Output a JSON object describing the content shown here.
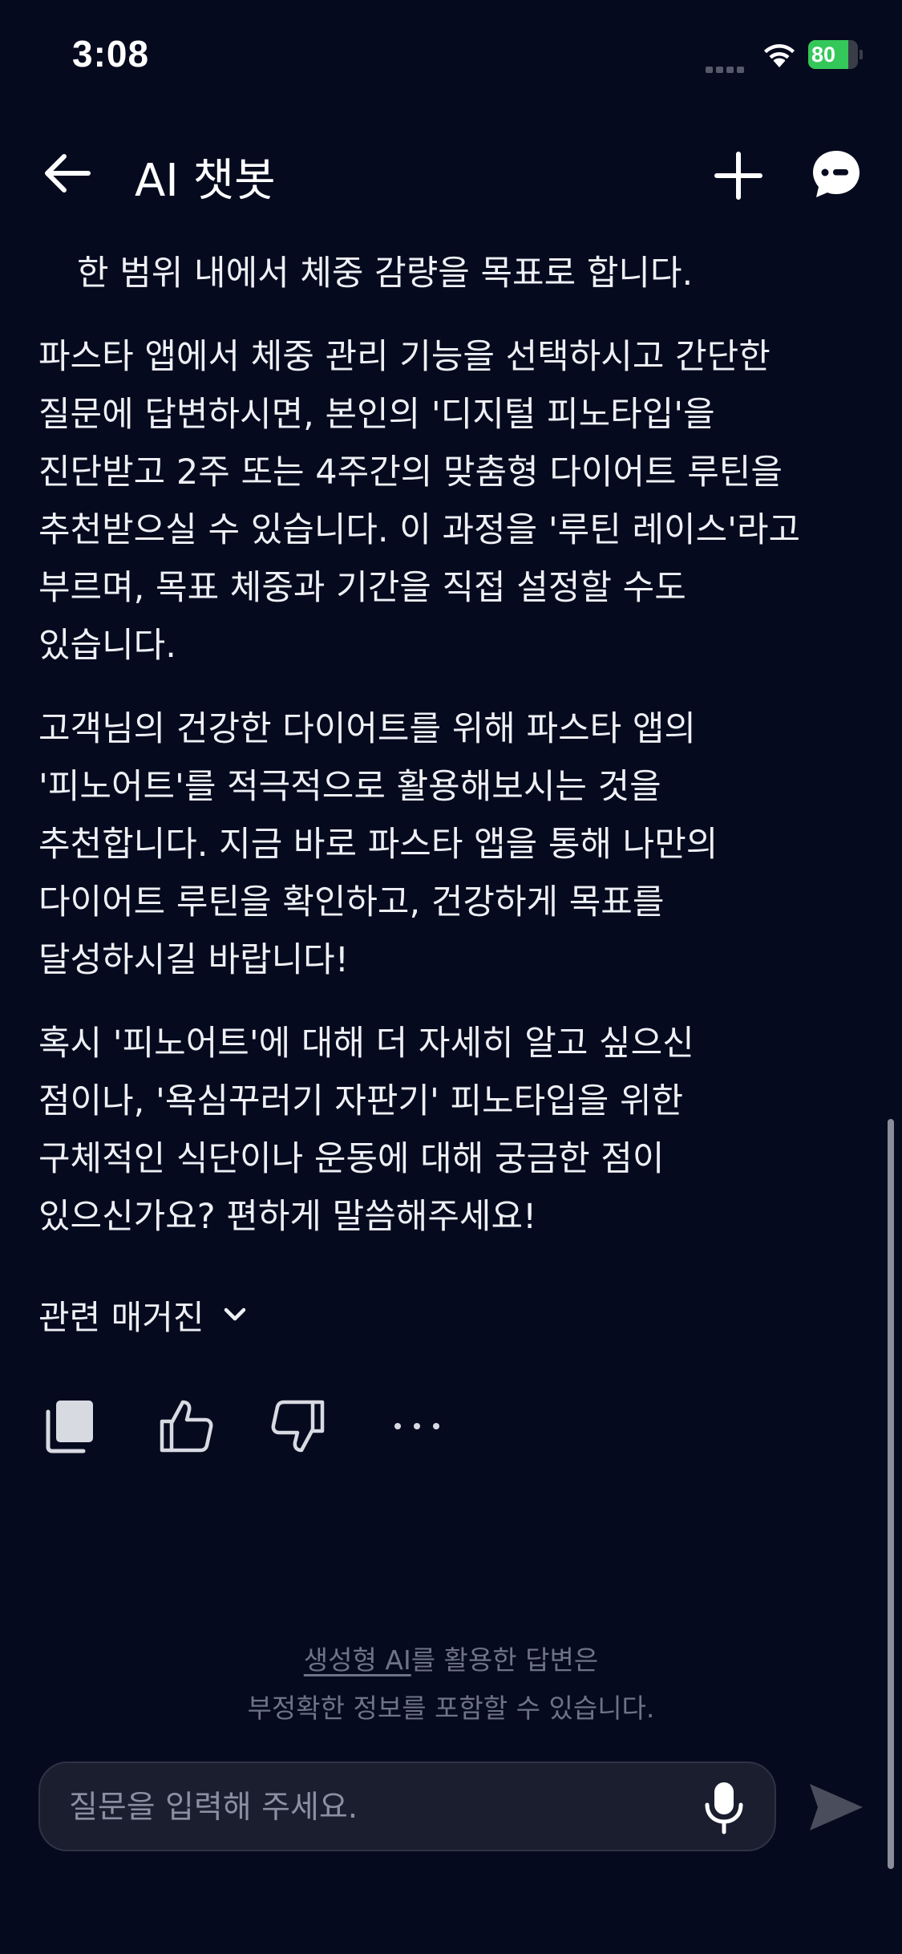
{
  "status_bar": {
    "time": "3:08",
    "battery_level": "80",
    "battery_fraction": 0.8,
    "signal_icon": "signal-dots-icon",
    "wifi_icon": "wifi-icon",
    "battery_icon": "battery-charging-icon"
  },
  "header": {
    "title": "AI 챗봇",
    "back_icon": "arrow-left-icon",
    "new_chat_icon": "plus-icon",
    "history_icon": "chat-bubble-icon"
  },
  "message": {
    "paragraphs": [
      "한 범위 내에서 체중 감량을 목표로 합니다.",
      "파스타 앱에서 체중 관리 기능을 선택하시고 간단한 질문에 답변하시면, 본인의 '디지털 피노타입'을 진단받고 2주 또는 4주간의 맞춤형 다이어트 루틴을 추천받으실 수 있습니다. 이 과정을 '루틴 레이스'라고 부르며, 목표 체중과 기간을 직접 설정할 수도 있습니다.",
      "고객님의 건강한 다이어트를 위해 파스타 앱의 '피노어트'를 적극적으로 활용해보시는 것을 추천합니다. 지금 바로 파스타 앱을 통해 나만의 다이어트 루틴을 확인하고, 건강하게 목표를 달성하시길 바랍니다!",
      "혹시 '피노어트'에 대해 더 자세히 알고 싶으신 점이나, '욕심꾸러기 자판기' 피노타입을 위한 구체적인 식단이나 운동에 대해 궁금한 점이 있으신가요? 편하게 말씀해주세요!"
    ],
    "related_label": "관련 매거진",
    "related_icon": "chevron-down-icon"
  },
  "actions": {
    "copy_icon": "copy-icon",
    "like_icon": "thumbs-up-icon",
    "dislike_icon": "thumbs-down-icon",
    "more_icon": "more-horizontal-icon"
  },
  "disclaimer": {
    "link_text": "생성형 AI",
    "line1_rest": "를 활용한 답변은",
    "line2": "부정확한 정보를 포함할 수 있습니다."
  },
  "input": {
    "placeholder": "질문을 입력해 주세요.",
    "value": "",
    "mic_icon": "microphone-icon",
    "send_icon": "send-icon"
  },
  "colors": {
    "background": "#060a1e",
    "text": "#eef0f5",
    "muted": "#6f7387",
    "input_bg": "#1b1e2e",
    "battery_green": "#34c759",
    "send_disabled": "#4a4d5c"
  }
}
